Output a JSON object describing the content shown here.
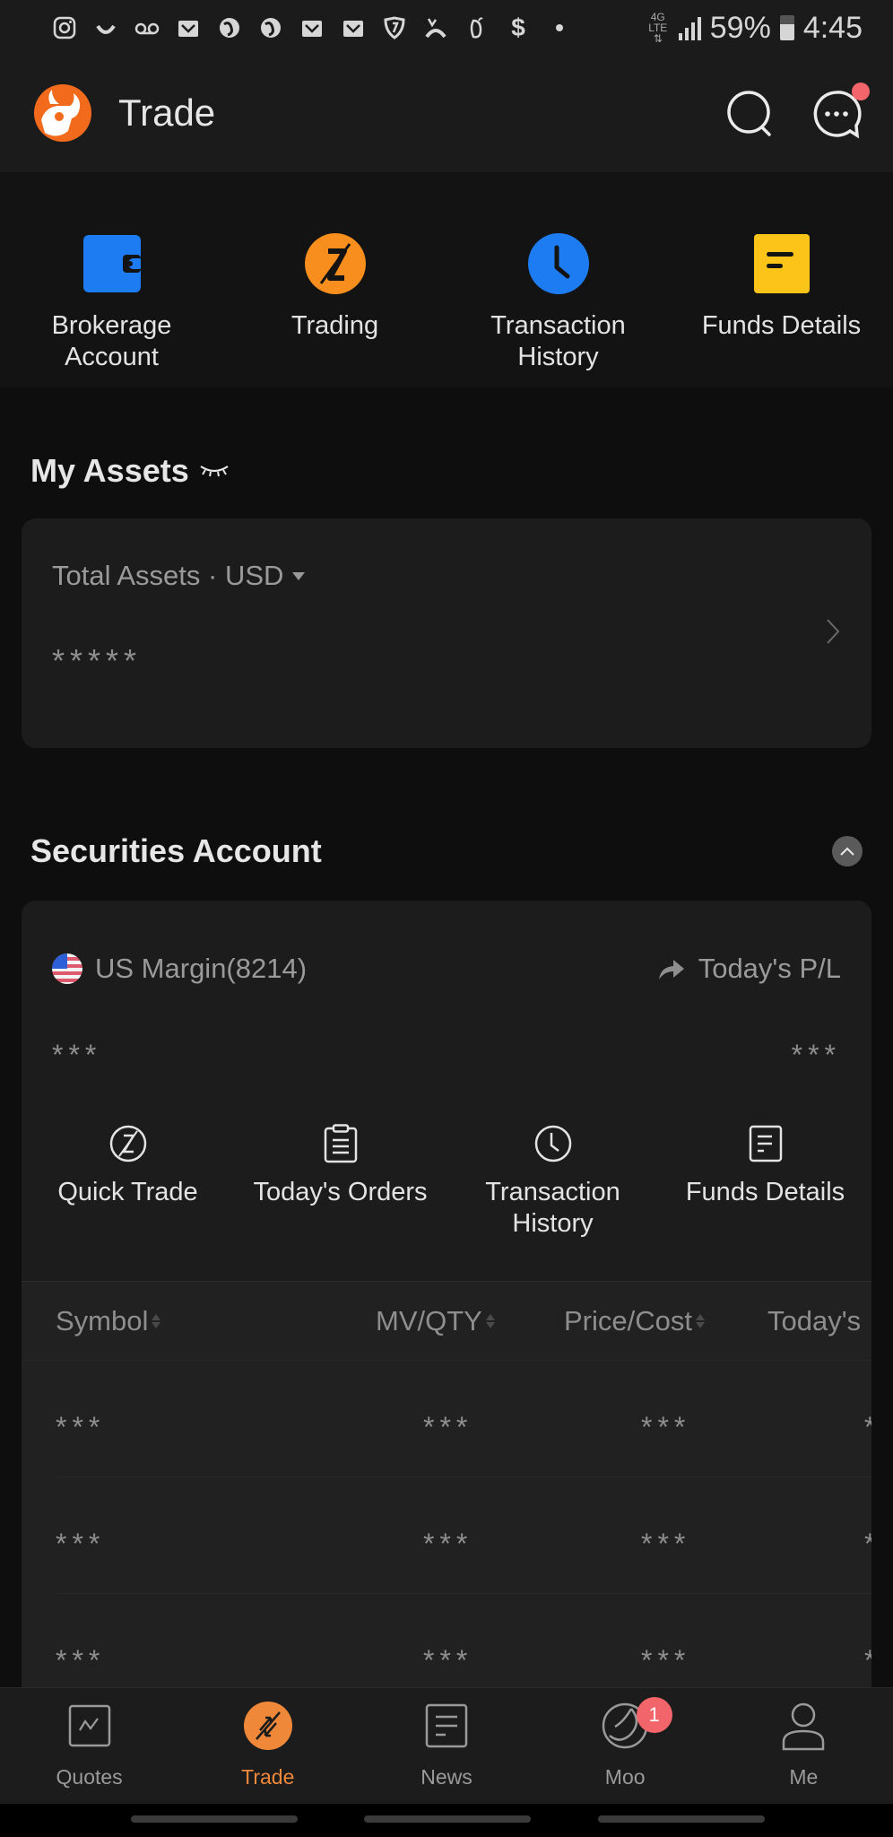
{
  "status_bar": {
    "notification_icons": [
      "instagram-icon",
      "amazon-icon",
      "voicemail-icon",
      "mail-icon",
      "app-icon",
      "app-icon",
      "mail-icon",
      "mail-icon",
      "shield-icon",
      "app-icon",
      "app-icon",
      "dollar-icon",
      "dot-icon"
    ],
    "network": "4G LTE",
    "battery": "59%",
    "time": "4:45"
  },
  "header": {
    "title": "Trade",
    "has_message_notification": true
  },
  "quick_actions": [
    {
      "label": "Brokerage\nAccount",
      "icon": "wallet-icon",
      "color": "#1e7cf2"
    },
    {
      "label": "Trading",
      "icon": "trade-icon",
      "color": "#f78e1e"
    },
    {
      "label": "Transaction\nHistory",
      "icon": "clock-icon",
      "color": "#1e7cf2"
    },
    {
      "label": "Funds Details",
      "icon": "document-icon",
      "color": "#fcc419"
    }
  ],
  "my_assets": {
    "title": "My Assets",
    "total_label": "Total Assets · USD",
    "total_value": "*****"
  },
  "securities_account": {
    "title": "Securities Account",
    "account_name": "US Margin(8214)",
    "pl_label": "Today's P/L",
    "account_value": "***",
    "pl_value": "***",
    "actions": [
      {
        "label": "Quick Trade",
        "icon": "quick-trade-icon"
      },
      {
        "label": "Today's Orders",
        "icon": "clipboard-icon"
      },
      {
        "label": "Transaction\nHistory",
        "icon": "clock-icon"
      },
      {
        "label": "Funds Details",
        "icon": "document-icon"
      }
    ],
    "table": {
      "columns": [
        "Symbol",
        "MV/QTY",
        "Price/Cost",
        "Today's"
      ],
      "rows": [
        [
          "***",
          "***",
          "***",
          "*"
        ],
        [
          "***",
          "***",
          "***",
          "*"
        ],
        [
          "***",
          "***",
          "***",
          "*"
        ]
      ]
    }
  },
  "bottom_nav": [
    {
      "label": "Quotes",
      "icon": "chart-icon",
      "active": false
    },
    {
      "label": "Trade",
      "icon": "trade-icon",
      "active": true
    },
    {
      "label": "News",
      "icon": "news-icon",
      "active": false
    },
    {
      "label": "Moo",
      "icon": "moo-icon",
      "active": false,
      "badge": "1"
    },
    {
      "label": "Me",
      "icon": "person-icon",
      "active": false
    }
  ],
  "colors": {
    "accent": "#f0883a",
    "badge": "#f2656b",
    "background": "#0e0e0e",
    "card": "#1c1c1c"
  }
}
